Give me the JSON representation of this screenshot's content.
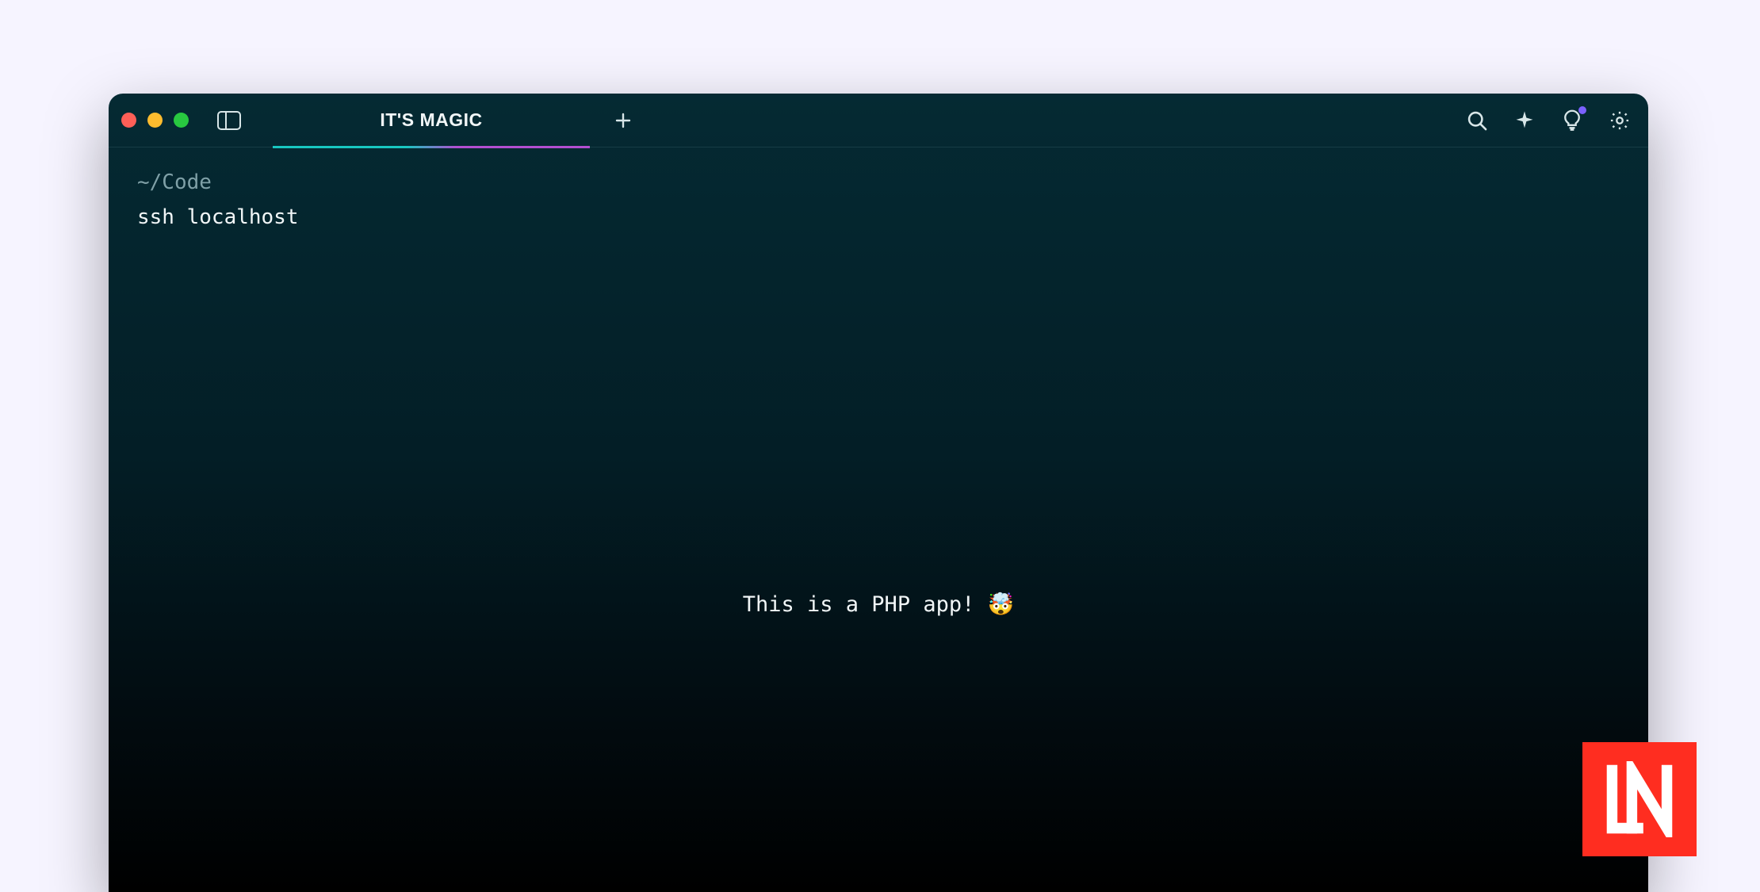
{
  "tab": {
    "title": "IT'S MAGIC"
  },
  "terminal": {
    "path": "~/Code",
    "command": "ssh localhost"
  },
  "center_message": "This is a PHP app! 🤯",
  "logo_text": "LN"
}
